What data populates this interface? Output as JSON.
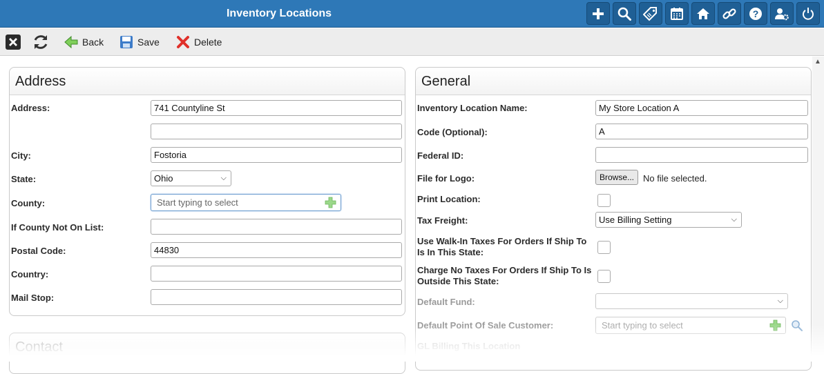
{
  "header": {
    "title": "Inventory Locations"
  },
  "header_icons": [
    "plus-icon",
    "search-icon",
    "tags-icon",
    "calendar-icon",
    "home-icon",
    "link-icon",
    "help-icon",
    "user-settings-icon",
    "power-icon"
  ],
  "toolbar": {
    "back_label": "Back",
    "save_label": "Save",
    "delete_label": "Delete"
  },
  "address": {
    "title": "Address",
    "address_label": "Address:",
    "address_value": "741 Countyline St",
    "address2_value": "",
    "city_label": "City:",
    "city_value": "Fostoria",
    "state_label": "State:",
    "state_value": "Ohio",
    "county_label": "County:",
    "county_placeholder": "Start typing to select",
    "county_not_on_list_label": "If County Not On List:",
    "county_not_on_list_value": "",
    "postal_label": "Postal Code:",
    "postal_value": "44830",
    "country_label": "Country:",
    "country_value": "",
    "mailstop_label": "Mail Stop:",
    "mailstop_value": ""
  },
  "contact": {
    "title": "Contact"
  },
  "general": {
    "title": "General",
    "name_label": "Inventory Location Name:",
    "name_value": "My Store Location A",
    "code_label": "Code (Optional):",
    "code_value": "A",
    "federal_label": "Federal ID:",
    "federal_value": "",
    "logo_label": "File for Logo:",
    "browse_label": "Browse...",
    "no_file_text": "No file selected.",
    "print_label": "Print Location:",
    "tax_freight_label": "Tax Freight:",
    "tax_freight_value": "Use Billing Setting",
    "walkin_label_1": "Use Walk-In Taxes For Orders If Ship To",
    "walkin_label_2": "Is In This State:",
    "notax_label_1": "Charge No Taxes For Orders If Ship To Is",
    "notax_label_2": "Outside This State:",
    "fund_label": "Default Fund:",
    "fund_value": "",
    "pos_customer_label": "Default Point Of Sale Customer:",
    "pos_customer_placeholder": "Start typing to select",
    "gl_billing_label": "GL Billing This Location"
  },
  "colors": {
    "header_bg": "#2e78b7",
    "header_btn": "#1f5f95",
    "toolbar_bg": "#ededed"
  }
}
